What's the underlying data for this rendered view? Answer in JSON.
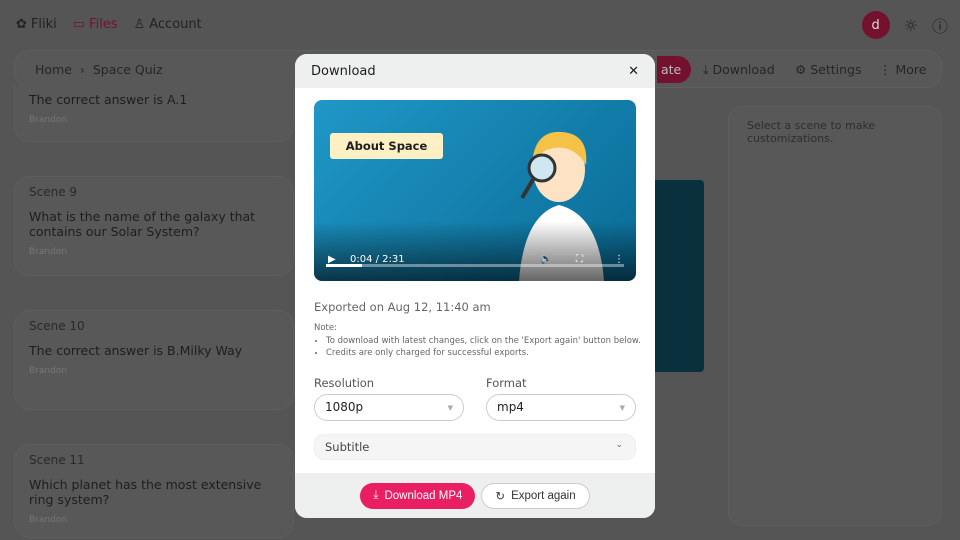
{
  "nav": {
    "logo": "Fliki",
    "files": "Files",
    "account": "Account",
    "avatar_letter": "d"
  },
  "toolbar": {
    "breadcrumb": [
      "Home",
      "Space Quiz"
    ],
    "create_partial": "ate",
    "download": "Download",
    "settings": "Settings",
    "more": "More"
  },
  "scenes": [
    {
      "title": "",
      "text": "The correct answer is A.1",
      "voice": "Brandon"
    },
    {
      "title": "Scene 9",
      "text": "What is the name of the galaxy that contains our Solar System?",
      "voice": "Brandon"
    },
    {
      "title": "Scene 10",
      "text": "The correct answer is B.Milky Way",
      "voice": "Brandon"
    },
    {
      "title": "Scene 11",
      "text": "Which planet has the most extensive ring system?",
      "voice": "Brandon"
    }
  ],
  "right_panel": {
    "hint": "Select a scene to make customizations."
  },
  "modal": {
    "title": "Download",
    "video": {
      "caption": "About Space",
      "time": "0:04 / 2:31",
      "progress_percent": 12
    },
    "exported": "Exported on Aug 12, 11:40 am",
    "note_label": "Note:",
    "notes": [
      "To download with latest changes, click on the 'Export again' button below.",
      "Credits are only charged for successful exports."
    ],
    "resolution_label": "Resolution",
    "resolution_value": "1080p",
    "format_label": "Format",
    "format_value": "mp4",
    "subtitle_label": "Subtitle",
    "download_button": "Download MP4",
    "export_button": "Export again"
  },
  "colors": {
    "accent": "#e91e63",
    "brand": "#b0184f"
  }
}
